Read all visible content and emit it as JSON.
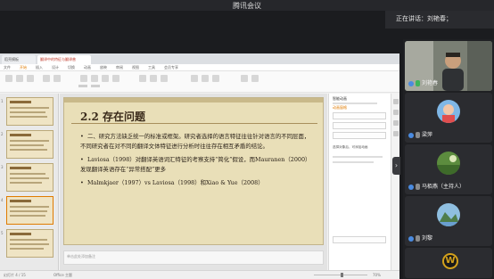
{
  "app": {
    "title": "腾讯会议"
  },
  "speaker": {
    "label": "正在讲话：刘艳春；"
  },
  "ppt": {
    "tabs": [
      "稻壳模板",
      "翻译中的特征与翻译普遍.pptx"
    ],
    "menus": [
      "文件",
      "开始",
      "插入",
      "设计",
      "切换",
      "动画",
      "放映",
      "审阅",
      "视图",
      "工具",
      "会员专享"
    ],
    "slide": {
      "title": "2.2 存在问题",
      "bullets": [
        "二、研究方法缺乏统一的标准或框架。研究者选择的语言特征往往针对语言的不同层面，不同研究者在对不同的翻译文体特征进行分析时往往存在相互矛盾的结论。",
        "Laviosa（1998）对翻译英语词汇特征的考察支持“简化”假设，而Mauranen（2000）发现翻译英语存在“异常搭配”更多",
        "Malmkjaer（1997）vs Laviosa（1998）和Xiao & Yue（2008）"
      ]
    },
    "notes_placeholder": "单击此处添加备注",
    "pane": {
      "header": "智能动画",
      "link": "动画窗格",
      "text": "选择对象后，可添加动画"
    },
    "status": {
      "slide_count": "幻灯片 4 / 15",
      "theme": "Office 主题",
      "zoom": "70%"
    }
  },
  "participants": [
    {
      "name": "刘艳春",
      "type": "video"
    },
    {
      "name": "梁萍",
      "type": "avatar"
    },
    {
      "name": "马栢燕（主持人）",
      "type": "avatar"
    },
    {
      "name": "刘黎",
      "type": "avatar"
    },
    {
      "name": "",
      "type": "logo"
    }
  ]
}
